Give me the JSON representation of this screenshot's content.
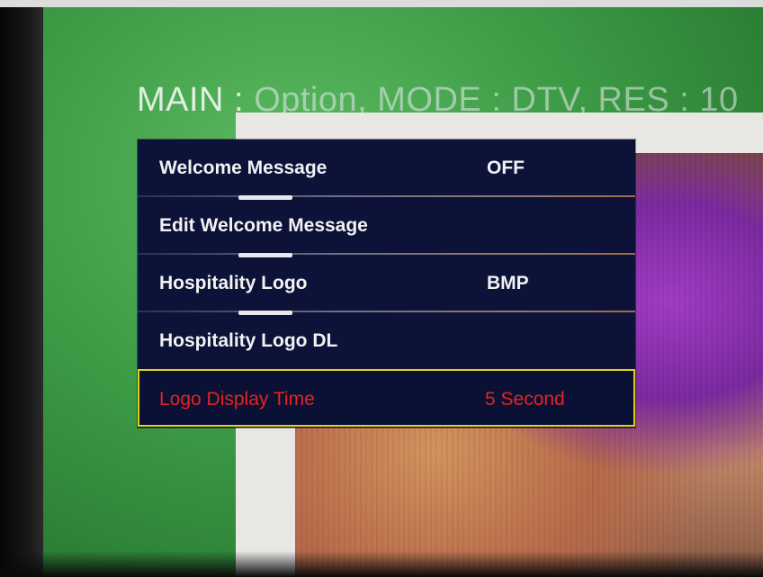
{
  "status_line": {
    "prefix": "MAIN : ",
    "text": "Option, MODE : DTV, RES : 10"
  },
  "menu": {
    "items": [
      {
        "label": "Welcome Message",
        "value": "OFF"
      },
      {
        "label": "Edit Welcome Message",
        "value": ""
      },
      {
        "label": "Hospitality Logo",
        "value": "BMP"
      },
      {
        "label": "Hospitality Logo DL",
        "value": ""
      },
      {
        "label": "Logo Display Time",
        "value": "5 Second"
      }
    ],
    "selected_index": 4
  },
  "colors": {
    "menu_background": "#0c1238",
    "menu_text": "#f2f2f2",
    "selected_text": "#e3251f",
    "selected_border": "#e4d21a"
  }
}
